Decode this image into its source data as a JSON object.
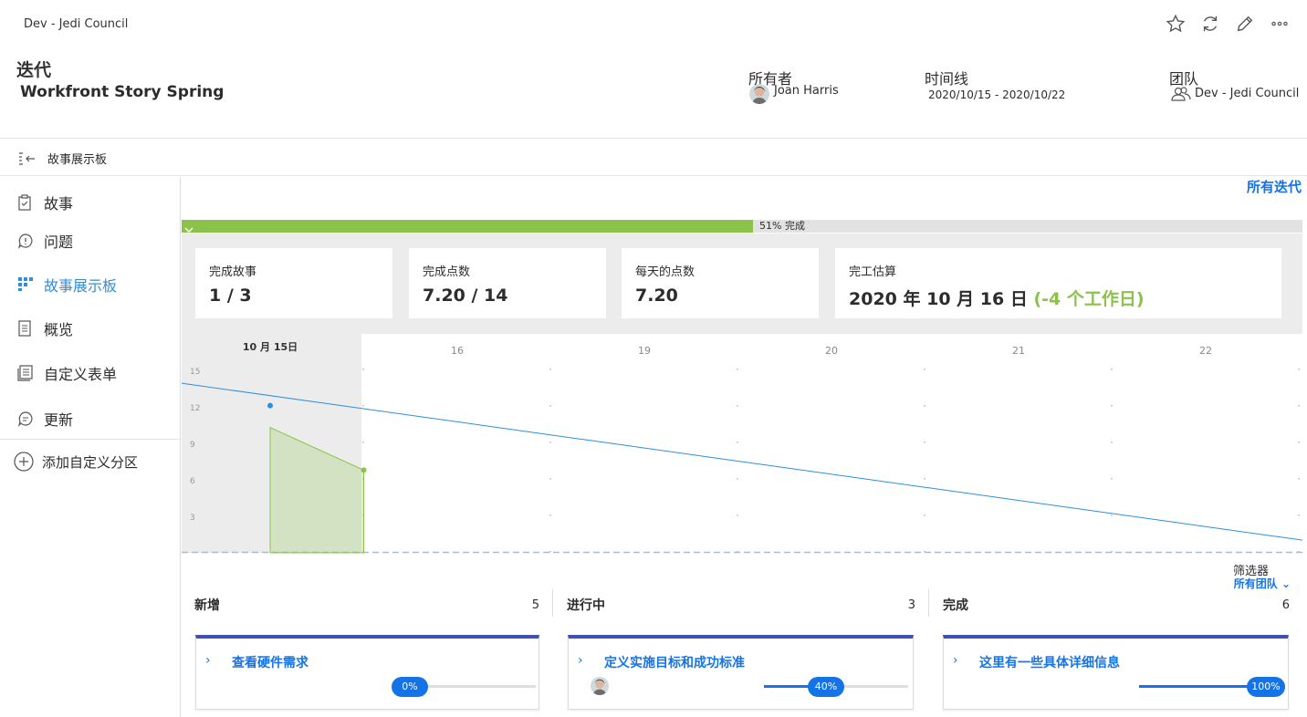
{
  "header": {
    "breadcrumb": "Dev - Jedi Council",
    "object_type": "迭代",
    "object_name": "Workfront Story Spring",
    "owner_label": "所有者",
    "owner_name": "Joan Harris",
    "timeline_label": "时间线",
    "timeline_value": "2020/10/15 - 2020/10/22",
    "team_label": "团队",
    "team_value": "Dev - Jedi Council",
    "actions": [
      "star-icon",
      "refresh-icon",
      "pencil-icon",
      "more-icon"
    ]
  },
  "section": {
    "title": "故事展示板"
  },
  "sidebar": {
    "items": [
      {
        "label": "故事",
        "icon": "clipboard-icon"
      },
      {
        "label": "问题",
        "icon": "issue-icon"
      },
      {
        "label": "故事展示板",
        "icon": "board-icon",
        "active": true
      },
      {
        "label": "概览",
        "icon": "document-icon"
      },
      {
        "label": "自定义表单",
        "icon": "form-icon"
      },
      {
        "label": "更新",
        "icon": "comment-icon"
      }
    ],
    "add_section": "添加自定义分区"
  },
  "main": {
    "all_iterations": "所有迭代",
    "progress": {
      "percent": 51,
      "text": "51% 完成"
    },
    "stats": [
      {
        "label": "完成故事",
        "value": "1 / 3"
      },
      {
        "label": "完成点数",
        "value": "7.20 / 14"
      },
      {
        "label": "每天的点数",
        "value": "7.20"
      },
      {
        "label": "完工估算",
        "value": "2020 年 10 月 16 日",
        "extra": "(-4 个工作日)"
      }
    ]
  },
  "chart_data": {
    "type": "area",
    "x": [
      "10 月 15日",
      "16",
      "19",
      "20",
      "21",
      "22"
    ],
    "y_ticks": [
      15,
      12,
      9,
      6,
      3
    ],
    "ylim": [
      0,
      15
    ],
    "series": [
      {
        "values": [
          14,
          12.1,
          10.1,
          8.1,
          6.2,
          4.2,
          0
        ],
        "x_index": [
          -0.5,
          0,
          1,
          2,
          3,
          4,
          6
        ]
      },
      {
        "values": [
          10.3,
          6.8
        ],
        "x_index": [
          0,
          0.5
        ]
      }
    ],
    "colors": {
      "ideal": "#2c8fe0",
      "actual": "#8bc34a",
      "current_day_bg": "#ececec"
    },
    "grid": true
  },
  "board": {
    "filter_label": "筛选器",
    "filter_value": "所有团队",
    "columns": [
      {
        "title": "新增",
        "count": "5",
        "story": "查看硬件需求",
        "progress": 0,
        "progress_text": "0%",
        "avatar": false
      },
      {
        "title": "进行中",
        "count": "3",
        "story": "定义实施目标和成功标准",
        "progress": 40,
        "progress_text": "40%",
        "avatar": true
      },
      {
        "title": "完成",
        "count": "6",
        "story": "这里有一些具体详细信息",
        "progress": 100,
        "progress_text": "100%",
        "avatar": false
      }
    ]
  }
}
